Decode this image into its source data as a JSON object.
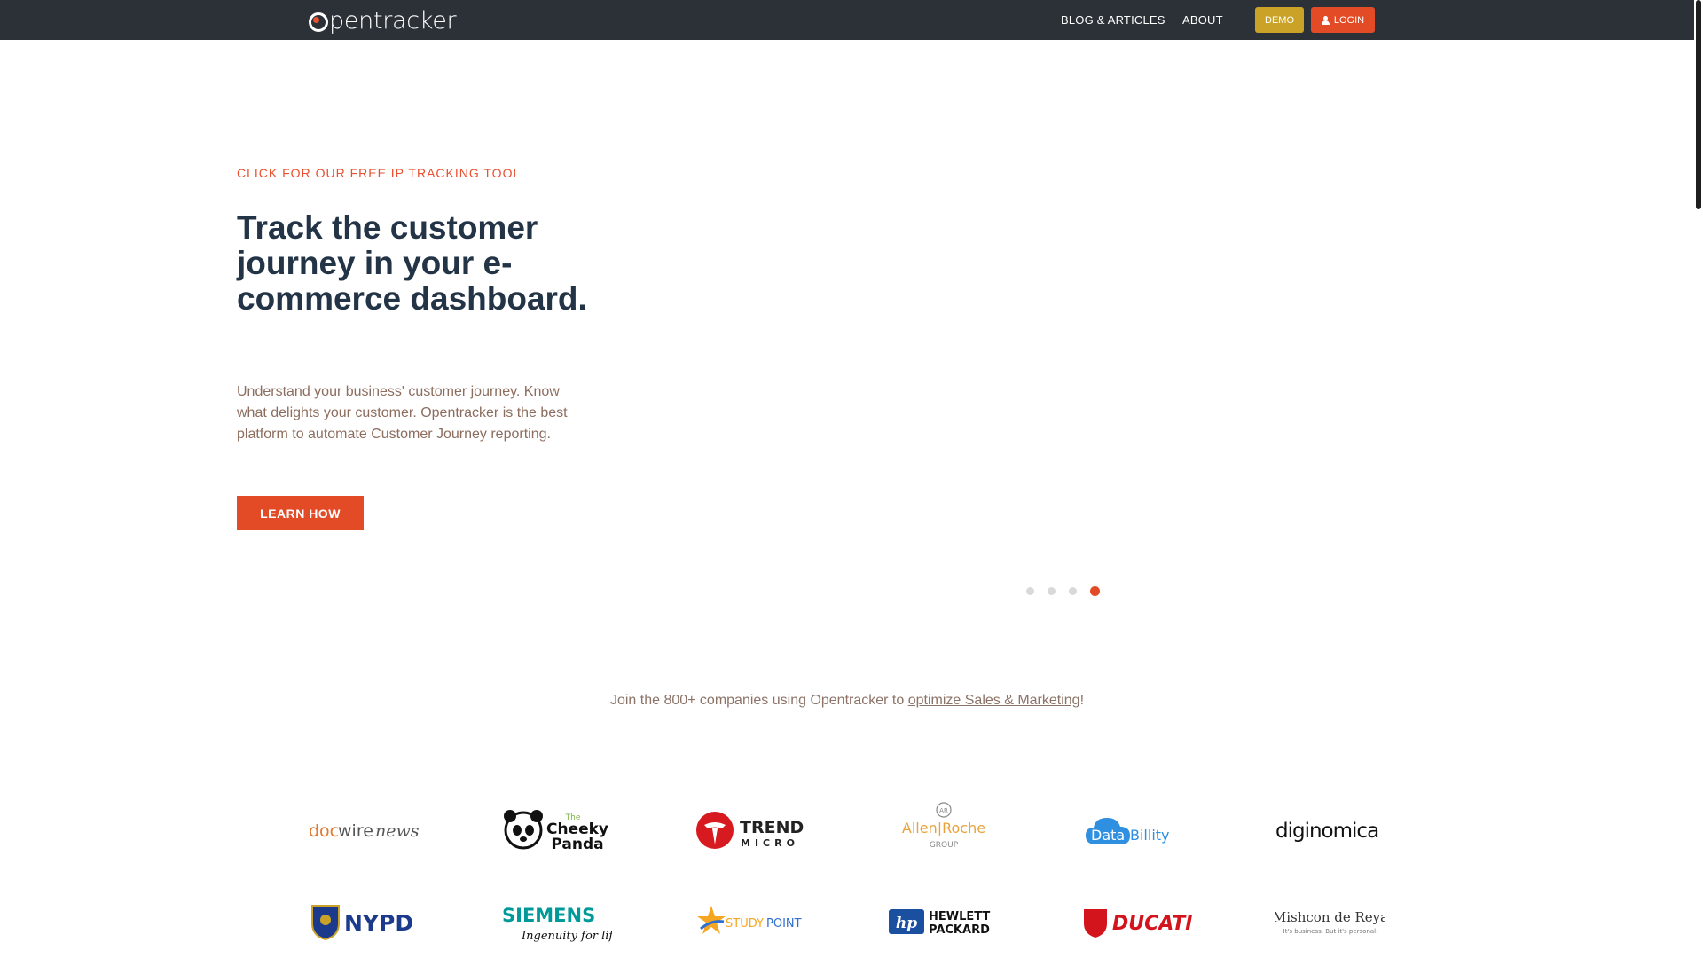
{
  "nav": {
    "logo": "opentracker",
    "links": [
      "BLOG & ARTICLES",
      "ABOUT"
    ],
    "demo_label": "DEMO",
    "login_label": "LOGIN"
  },
  "hero": {
    "eyebrow": "CLICK FOR OUR FREE IP TRACKING TOOL",
    "title": "Track the customer journey in your e-commerce dashboard.",
    "body": "Understand your business' customer journey. Know what delights your customer. Opentracker is the best platform to automate Customer Journey reporting.",
    "cta": "LEARN HOW",
    "slides_count": 4,
    "active_slide": 4
  },
  "companies": {
    "text_before": "Join the 800+ companies using Opentracker to ",
    "link_text": "optimize Sales & Marketing",
    "text_after": "!",
    "logos_row1": [
      "docwirenews",
      "The Cheeky Panda",
      "TREND MICRO",
      "Allen|Roche GROUP",
      "DataBillity",
      "diginomica"
    ],
    "logos_row2": [
      "NYPD",
      "SIEMENS Ingenuity for life",
      "STUDYPOINT",
      "HEWLETT PACKARD",
      "DUCATI",
      "Mishcon de Reya It's business. But it's personal."
    ]
  },
  "colors": {
    "accent": "#e34b27",
    "demo": "#c9a227",
    "nav_bg": "#2c3137",
    "title": "#233447"
  }
}
